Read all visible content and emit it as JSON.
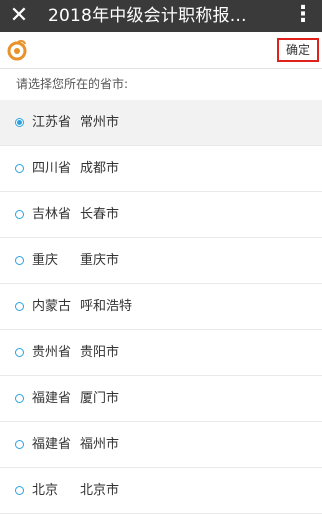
{
  "window": {
    "title": "2018年中级会计职称报…",
    "close_icon": "close-icon",
    "more_icon": "more-vertical-icon"
  },
  "toolbar": {
    "logo_icon": "app-logo-icon",
    "confirm_label": "确定"
  },
  "prompt": "请选择您所在的省市:",
  "colors": {
    "titlebar": "#3a3a3a",
    "accent_radio": "#2aa3e0",
    "highlight_border": "#e0201c",
    "logo": "#e8922a"
  },
  "locations": [
    {
      "province": "江苏省",
      "city": "常州市",
      "selected": true
    },
    {
      "province": "四川省",
      "city": "成都市",
      "selected": false
    },
    {
      "province": "吉林省",
      "city": "长春市",
      "selected": false
    },
    {
      "province": "重庆",
      "city": "重庆市",
      "selected": false
    },
    {
      "province": "内蒙古",
      "city": "呼和浩特",
      "selected": false
    },
    {
      "province": "贵州省",
      "city": "贵阳市",
      "selected": false
    },
    {
      "province": "福建省",
      "city": "厦门市",
      "selected": false
    },
    {
      "province": "福建省",
      "city": "福州市",
      "selected": false
    },
    {
      "province": "北京",
      "city": "北京市",
      "selected": false
    }
  ]
}
